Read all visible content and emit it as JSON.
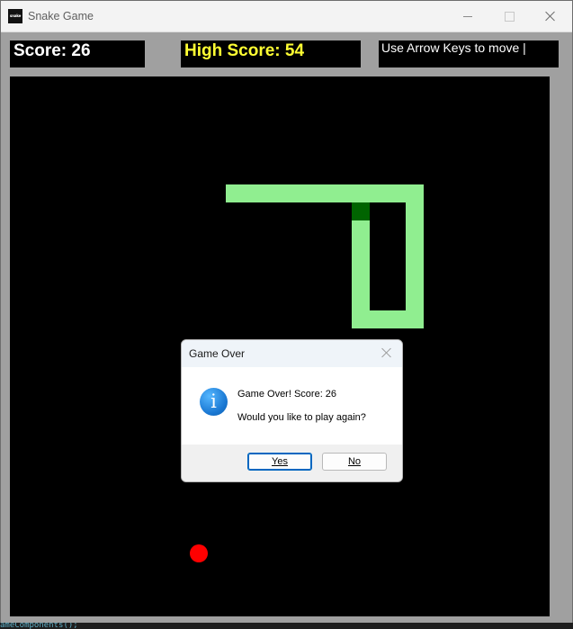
{
  "window": {
    "title": "Snake Game",
    "icon_text": "snake"
  },
  "hud": {
    "score_text": "Score: 26",
    "high_score_text": "High Score: 54",
    "instructions": "Use Arrow Keys to move |"
  },
  "colors": {
    "board": "#000000",
    "snake_body": "#90ee90",
    "snake_head": "#006400",
    "food": "#ff0000",
    "high_score": "#ffff33"
  },
  "dialog": {
    "title": "Game Over",
    "message_line1": "Game Over! Score: 26",
    "message_line2": "Would you like to play again?",
    "yes_label": "Yes",
    "no_label": "No",
    "icon": "info-icon"
  },
  "console_fragment": "ameComponents();"
}
